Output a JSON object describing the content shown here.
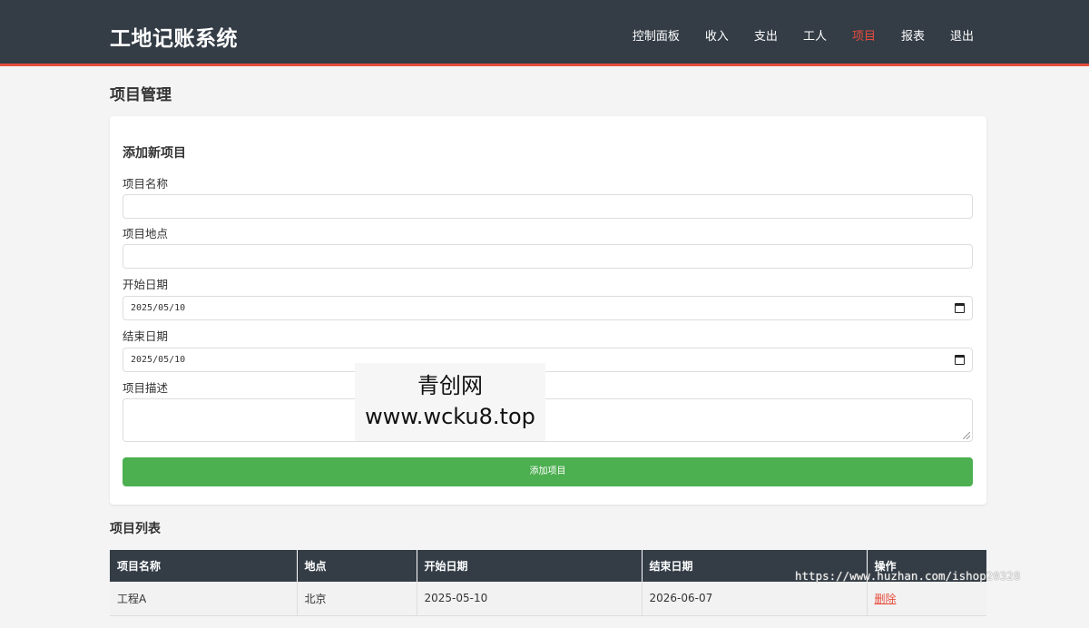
{
  "header": {
    "brand": "工地记账系统",
    "nav": [
      "控制面板",
      "收入",
      "支出",
      "工人",
      "项目",
      "报表",
      "退出"
    ],
    "active_index": 4
  },
  "page_title": "项目管理",
  "form": {
    "title": "添加新项目",
    "name_label": "项目名称",
    "name_value": "",
    "location_label": "项目地点",
    "location_value": "",
    "start_label": "开始日期",
    "start_value": "2025/05/10",
    "end_label": "结束日期",
    "end_value": "2025/05/10",
    "desc_label": "项目描述",
    "desc_value": "",
    "submit_label": "添加项目"
  },
  "list": {
    "title": "项目列表",
    "columns": [
      "项目名称",
      "地点",
      "开始日期",
      "结束日期",
      "操作"
    ],
    "rows": [
      {
        "name": "工程A",
        "location": "北京",
        "start": "2025-05-10",
        "end": "2026-06-07",
        "action": "删除"
      }
    ]
  },
  "watermark": {
    "line1": "青创网",
    "line2": "www.wcku8.top",
    "url": "https://www.huzhan.com/ishop20328"
  },
  "colors": {
    "header_bg": "#343d46",
    "accent": "#e74c3c",
    "button_green": "#4caf50"
  }
}
